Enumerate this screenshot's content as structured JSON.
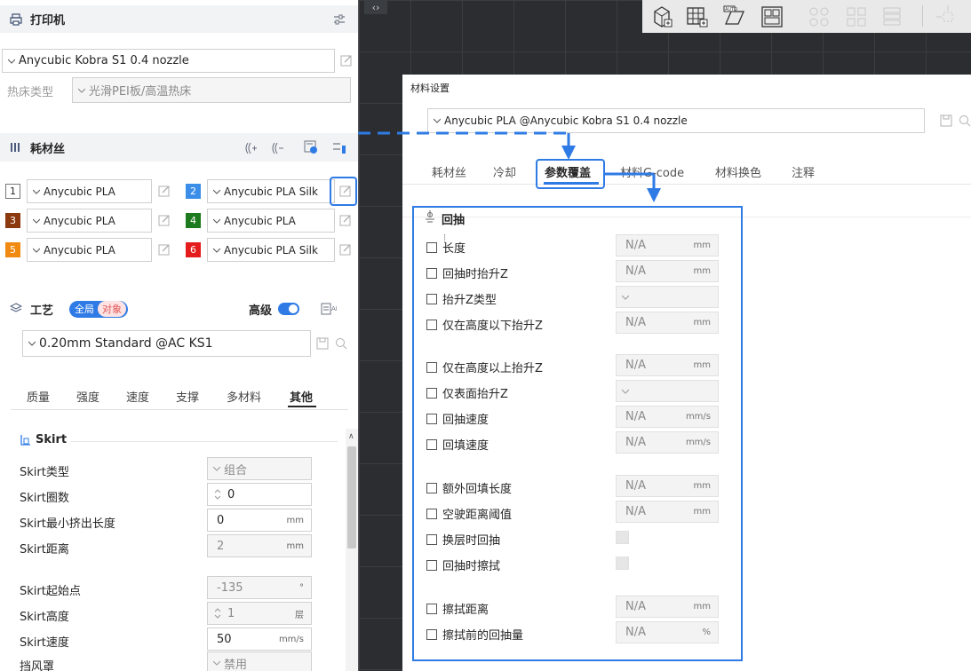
{
  "printer": {
    "title": "打印机",
    "preset": "Anycubic Kobra S1 0.4 nozzle",
    "bed_label": "热床类型",
    "bed_value": "光滑PEI板/高温热床"
  },
  "filament": {
    "title": "耗材丝",
    "slots": [
      {
        "num": "1",
        "name": "Anycubic PLA",
        "color": "#ffffff",
        "text_color": "#262626"
      },
      {
        "num": "2",
        "name": "Anycubic PLA Silk",
        "color": "#3b8ee8",
        "text_color": "#ffffff"
      },
      {
        "num": "3",
        "name": "Anycubic PLA",
        "color": "#8b3a0f",
        "text_color": "#ffffff"
      },
      {
        "num": "4",
        "name": "Anycubic PLA",
        "color": "#1e7a1e",
        "text_color": "#ffffff"
      },
      {
        "num": "5",
        "name": "Anycubic PLA",
        "color": "#f08a10",
        "text_color": "#ffffff"
      },
      {
        "num": "6",
        "name": "Anycubic PLA Silk",
        "color": "#e51c1c",
        "text_color": "#ffffff"
      }
    ]
  },
  "process": {
    "title": "工艺",
    "badge_global": "全局",
    "badge_object": "对象",
    "advanced_label": "高级",
    "preset": "0.20mm Standard @AC KS1",
    "tabs": [
      "质量",
      "强度",
      "速度",
      "支撑",
      "多材料",
      "其他"
    ],
    "active_tab": "其他"
  },
  "skirt": {
    "title": "Skirt",
    "rows": [
      {
        "label": "Skirt类型",
        "value": "组合",
        "unit": "",
        "kind": "select",
        "enabled": false
      },
      {
        "label": "Skirt圈数",
        "value": "0",
        "unit": "",
        "kind": "stepper",
        "enabled": true
      },
      {
        "label": "Skirt最小挤出长度",
        "value": "0",
        "unit": "mm",
        "kind": "text",
        "enabled": true
      },
      {
        "label": "Skirt距离",
        "value": "2",
        "unit": "mm",
        "kind": "text",
        "enabled": false
      },
      {
        "label": "Skirt起始点",
        "value": "-135",
        "unit": "°",
        "kind": "text",
        "enabled": false
      },
      {
        "label": "Skirt高度",
        "value": "1",
        "unit": "层",
        "kind": "stepper",
        "enabled": false
      },
      {
        "label": "Skirt速度",
        "value": "50",
        "unit": "mm/s",
        "kind": "text",
        "enabled": true
      },
      {
        "label": "挡风罩",
        "value": "禁用",
        "unit": "",
        "kind": "select",
        "enabled": false
      }
    ]
  },
  "dialog": {
    "title": "材料设置",
    "preset": "Anycubic PLA @Anycubic Kobra S1 0.4 nozzle",
    "tabs": [
      "耗材丝",
      "冷却",
      "参数覆盖",
      "材料G-code",
      "材料换色",
      "注释"
    ],
    "active_tab": "参数覆盖",
    "retraction_title": "回抽",
    "rows": [
      {
        "label": "长度",
        "value": "N/A",
        "unit": "mm",
        "kind": "text"
      },
      {
        "label": "回抽时抬升Z",
        "value": "N/A",
        "unit": "mm",
        "kind": "text"
      },
      {
        "label": "抬升Z类型",
        "value": "",
        "unit": "",
        "kind": "select"
      },
      {
        "label": "仅在高度以下抬升Z",
        "value": "N/A",
        "unit": "mm",
        "kind": "text"
      },
      {
        "label": "仅在高度以上抬升Z",
        "value": "N/A",
        "unit": "mm",
        "kind": "text"
      },
      {
        "label": "仅表面抬升Z",
        "value": "",
        "unit": "",
        "kind": "select"
      },
      {
        "label": "回抽速度",
        "value": "N/A",
        "unit": "mm/s",
        "kind": "text"
      },
      {
        "label": "回填速度",
        "value": "N/A",
        "unit": "mm/s",
        "kind": "text"
      },
      {
        "label": "额外回填长度",
        "value": "N/A",
        "unit": "mm",
        "kind": "text"
      },
      {
        "label": "空驶距离阈值",
        "value": "N/A",
        "unit": "mm",
        "kind": "text"
      },
      {
        "label": "换层时回抽",
        "value": "",
        "unit": "",
        "kind": "check"
      },
      {
        "label": "回抽时擦拭",
        "value": "",
        "unit": "",
        "kind": "check"
      },
      {
        "label": "擦拭距离",
        "value": "N/A",
        "unit": "mm",
        "kind": "text"
      },
      {
        "label": "擦拭前的回抽量",
        "value": "N/A",
        "unit": "%",
        "kind": "text"
      }
    ]
  },
  "colors": {
    "accent": "#2f7be6",
    "toggle": "#2f7be6"
  }
}
